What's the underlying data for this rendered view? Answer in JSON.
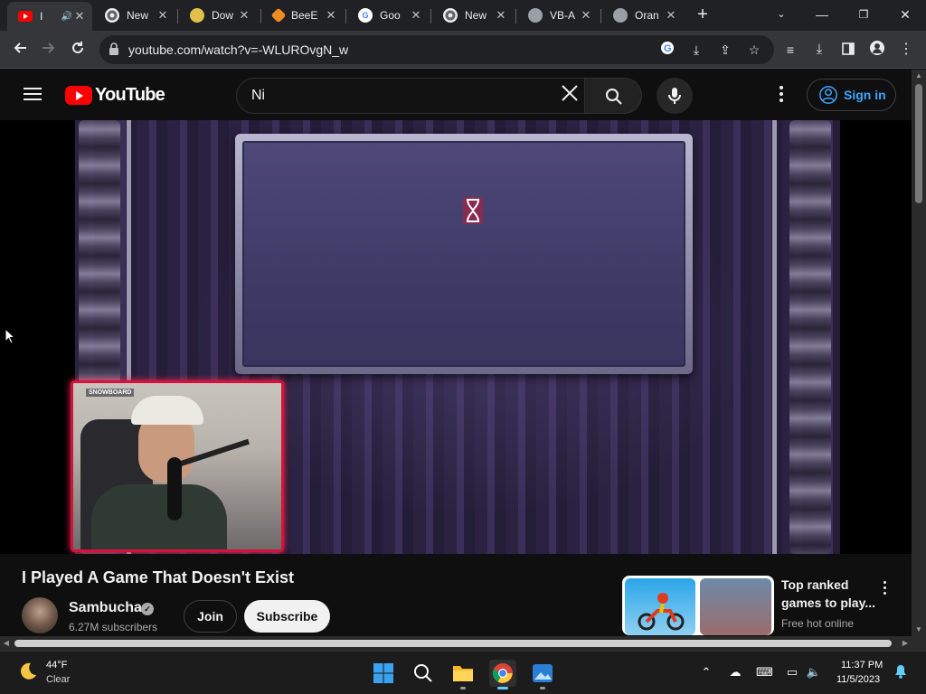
{
  "browser": {
    "tabs": [
      {
        "title": "I",
        "favicon": "youtube-icon",
        "active": true,
        "audio": true
      },
      {
        "title": "New",
        "favicon": "chrome-icon"
      },
      {
        "title": "Dow",
        "favicon": "download-app-icon"
      },
      {
        "title": "BeeE",
        "favicon": "beebom-icon"
      },
      {
        "title": "Goo",
        "favicon": "google-icon"
      },
      {
        "title": "New",
        "favicon": "chrome-icon"
      },
      {
        "title": "VB-A",
        "favicon": "globe-icon"
      },
      {
        "title": "Oran",
        "favicon": "globe-icon"
      }
    ],
    "url": "youtube.com/watch?v=-WLUROvgN_w"
  },
  "youtube": {
    "logo_text": "YouTube",
    "search_query": "Ni",
    "sign_in_label": "Sign in",
    "video": {
      "title": "I Played A Game That Doesn't Exist",
      "channel_name": "Sambucha",
      "subscribers": "6.27M subscribers",
      "join_label": "Join",
      "subscribe_label": "Subscribe",
      "webcam_tag": "SNOWBOARD"
    },
    "ad": {
      "title": "Top ranked games to play...",
      "subtitle": "Free hot online"
    }
  },
  "taskbar": {
    "weather_temp": "44°F",
    "weather_condition": "Clear",
    "time": "11:37 PM",
    "date": "11/5/2023"
  },
  "colors": {
    "youtube_red": "#ff0000",
    "link_blue": "#3ea6ff",
    "webcam_border": "#d2143c",
    "taskbar_accent": "#60cdff"
  }
}
